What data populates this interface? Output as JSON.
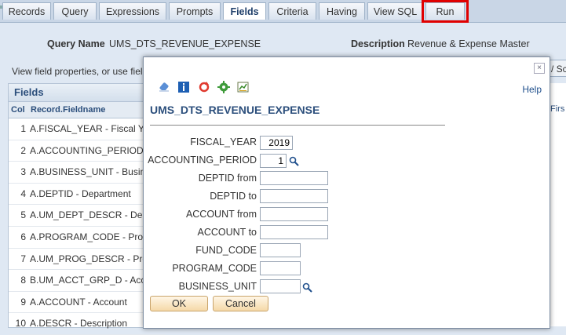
{
  "tabs": [
    {
      "label": "Records"
    },
    {
      "label": "Query"
    },
    {
      "label": "Expressions"
    },
    {
      "label": "Prompts"
    },
    {
      "label": "Fields"
    },
    {
      "label": "Criteria"
    },
    {
      "label": "Having"
    },
    {
      "label": "View SQL"
    },
    {
      "label": "Run"
    }
  ],
  "header": {
    "query_name_label": "Query Name",
    "query_name_value": "UMS_DTS_REVENUE_EXPENSE",
    "description_label": "Description",
    "description_value": "Revenue & Expense Master"
  },
  "instruction": "View field properties, or use fiel",
  "right_button_label": "/ Sc",
  "grid": {
    "title": "Fields",
    "col_header": "Col",
    "field_header": "Record.Fieldname",
    "right_header": "Firs",
    "rows": [
      {
        "num": "1",
        "name": "A.FISCAL_YEAR - Fiscal Y"
      },
      {
        "num": "2",
        "name": "A.ACCOUNTING_PERIOD"
      },
      {
        "num": "3",
        "name": "A.BUSINESS_UNIT - Busin"
      },
      {
        "num": "4",
        "name": "A.DEPTID - Department"
      },
      {
        "num": "5",
        "name": "A.UM_DEPT_DESCR - Dep"
      },
      {
        "num": "6",
        "name": "A.PROGRAM_CODE - Prog"
      },
      {
        "num": "7",
        "name": "A.UM_PROG_DESCR - Pro"
      },
      {
        "num": "8",
        "name": "B.UM_ACCT_GRP_D - Acc"
      },
      {
        "num": "9",
        "name": "A.ACCOUNT - Account"
      },
      {
        "num": "10",
        "name": "A.DESCR - Description"
      }
    ]
  },
  "modal": {
    "title": "UMS_DTS_REVENUE_EXPENSE",
    "help": "Help",
    "close": "×",
    "prompts": [
      {
        "label": "FISCAL_YEAR",
        "value": "2019"
      },
      {
        "label": "ACCOUNTING_PERIOD",
        "value": "1"
      },
      {
        "label": "DEPTID from",
        "value": ""
      },
      {
        "label": "DEPTID to",
        "value": ""
      },
      {
        "label": "ACCOUNT from",
        "value": ""
      },
      {
        "label": "ACCOUNT to",
        "value": ""
      },
      {
        "label": "FUND_CODE",
        "value": ""
      },
      {
        "label": "PROGRAM_CODE",
        "value": ""
      },
      {
        "label": "BUSINESS_UNIT",
        "value": ""
      }
    ],
    "ok_label": "OK",
    "cancel_label": "Cancel"
  },
  "colors": {
    "highlight": "#e00000",
    "title": "#2c4f7c",
    "link": "#1f4f8c"
  }
}
